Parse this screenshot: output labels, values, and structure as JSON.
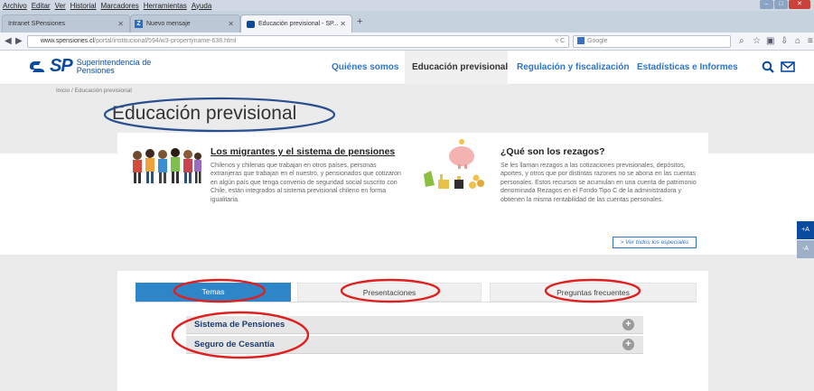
{
  "browser": {
    "menu": [
      "Archivo",
      "Editar",
      "Ver",
      "Historial",
      "Marcadores",
      "Herramientas",
      "Ayuda"
    ],
    "tabs": [
      {
        "title": "Intranet SPensiones"
      },
      {
        "title": "Nuevo mensaje"
      },
      {
        "title": "Educación previsional - SP..."
      }
    ],
    "new_tab": "+",
    "url_domain": "www.spensiones.cl",
    "url_path": "/portal/institucional/594/w3-propertyname-638.html",
    "search_placeholder": "Google"
  },
  "site": {
    "logo_mark": "SP",
    "logo_name_1": "Superintendencia de",
    "logo_name_2": "Pensiones",
    "nav": [
      "Quiénes somos",
      "Educación previsional",
      "Regulación y fiscalización",
      "Estadísticas e Informes"
    ],
    "breadcrumb": "Inicio / Educación previsional",
    "page_title": "Educación previsional"
  },
  "specials": {
    "item1_title": "Los migrantes y el sistema de pensiones",
    "item1_text": "Chilenos y chilenas que trabajan en otros países, personas extranjeras que trabajan en el nuestro, y pensionados que cotizaron en algún país que tenga convenio de seguridad social suscrito con Chile, están integrados al sistema previsional chileno en forma igualitaria.",
    "item2_title": "¿Qué son los rezagos?",
    "item2_text": "Se les llaman rezagos a las cotizaciones previsionales, depósitos, aportes, y otros que por distintas razones no se abona en las cuentas personales. Estos recursos se acumulan en una cuenta de patrimonio denominada Rezagos en el Fondo Tipo C de la administradora y obtienen la misma rentabilidad de las cuentas personales.",
    "see_all": "> Ver todos los especiales"
  },
  "content_tabs": [
    "Temas",
    "Presentaciones",
    "Preguntas frecuentes"
  ],
  "accordion": [
    "Sistema de Pensiones",
    "Seguro de Cesantía"
  ],
  "font_controls": {
    "increase": "+A",
    "decrease": "-A"
  },
  "colors": {
    "brand": "#0a4a9f",
    "link": "#2e74c9",
    "active_tab": "#2e86c8",
    "annotation": "#e02020"
  }
}
